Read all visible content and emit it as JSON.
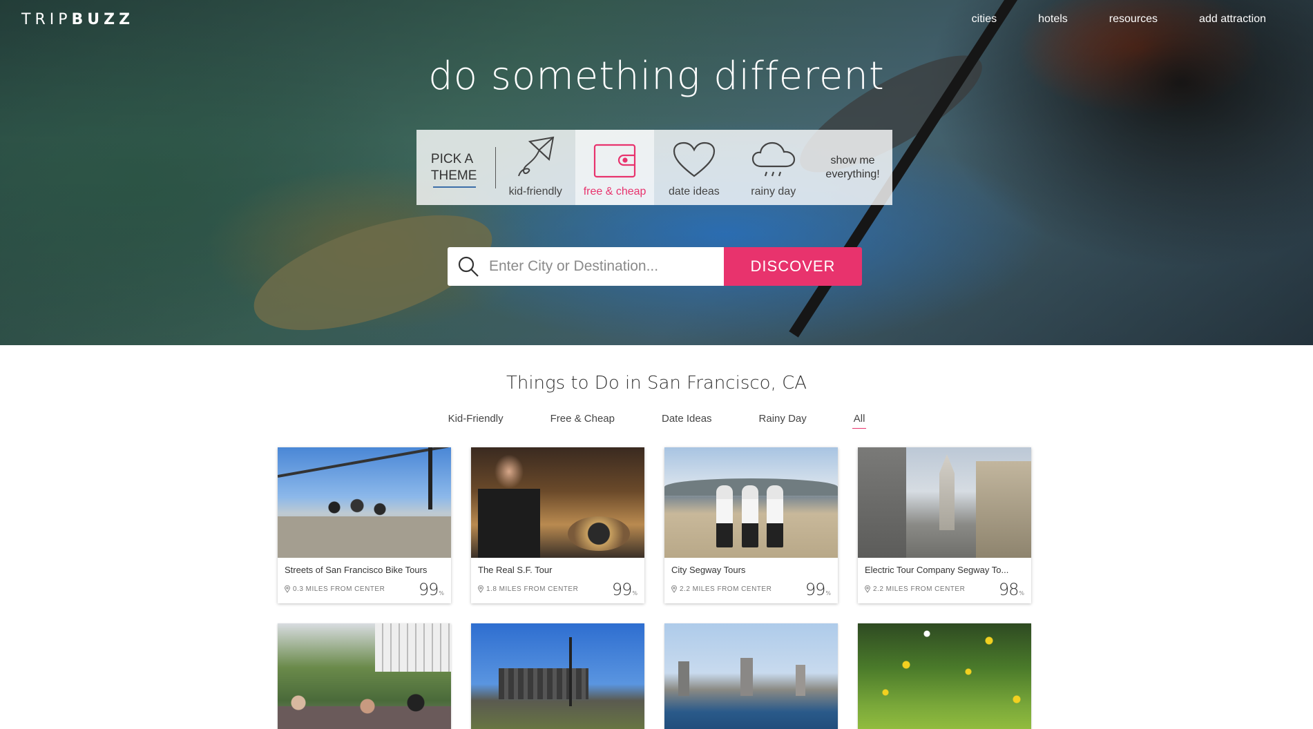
{
  "brand": {
    "logo_light": "TRIP",
    "logo_bold": "BUZZ"
  },
  "nav": {
    "items": [
      {
        "label": "cities"
      },
      {
        "label": "hotels"
      },
      {
        "label": "resources"
      },
      {
        "label": "add attraction"
      }
    ]
  },
  "hero": {
    "tagline": "do something different",
    "theme_picker": {
      "heading_line1": "PICK A",
      "heading_line2": "THEME",
      "themes": [
        {
          "label": "kid-friendly",
          "icon": "kite-icon",
          "active": false
        },
        {
          "label": "free & cheap",
          "icon": "wallet-icon",
          "active": true
        },
        {
          "label": "date ideas",
          "icon": "heart-icon",
          "active": false
        },
        {
          "label": "rainy day",
          "icon": "rain-cloud-icon",
          "active": false
        }
      ],
      "show_all": "show me\neverything!"
    },
    "search": {
      "placeholder": "Enter City or Destination...",
      "value": "",
      "button_label": "DISCOVER"
    }
  },
  "listing": {
    "title": "Things to Do in San Francisco, CA",
    "filters": [
      {
        "label": "Kid-Friendly",
        "active": false
      },
      {
        "label": "Free & Cheap",
        "active": false
      },
      {
        "label": "Date Ideas",
        "active": false
      },
      {
        "label": "Rainy Day",
        "active": false
      },
      {
        "label": "All",
        "active": true
      }
    ],
    "cards": [
      {
        "name": "Streets of San Francisco Bike Tours",
        "distance": "0.3 MILES FROM CENTER",
        "score": "99",
        "score_unit": "%"
      },
      {
        "name": "The Real S.F. Tour",
        "distance": "1.8 MILES FROM CENTER",
        "score": "99",
        "score_unit": "%"
      },
      {
        "name": "City Segway Tours",
        "distance": "2.2 MILES FROM CENTER",
        "score": "99",
        "score_unit": "%"
      },
      {
        "name": "Electric Tour Company Segway To...",
        "distance": "2.2 MILES FROM CENTER",
        "score": "98",
        "score_unit": "%"
      }
    ]
  },
  "colors": {
    "accent": "#e8336d",
    "text": "#333333",
    "nav_text": "#ffffff",
    "theme_underline": "#3b6ea8"
  }
}
